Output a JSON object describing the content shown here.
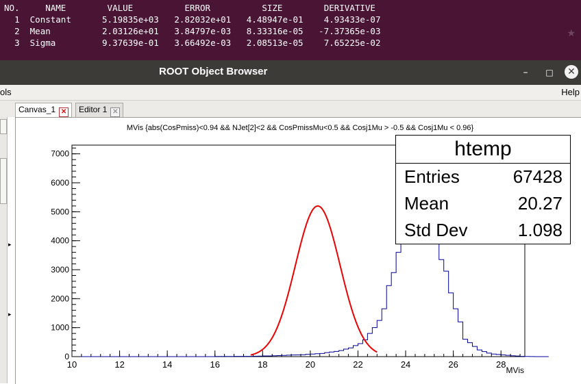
{
  "terminal": {
    "headers": [
      "NO.",
      "NAME",
      "VALUE",
      "ERROR",
      "SIZE",
      "DERIVATIVE"
    ],
    "rows": [
      [
        "1",
        "Constant",
        "5.19835e+03",
        "2.82032e+01",
        "4.48947e-01",
        "4.93433e-07"
      ],
      [
        "2",
        "Mean",
        "2.03126e+01",
        "3.84797e-03",
        "8.33316e-05",
        "-7.37365e-03"
      ],
      [
        "3",
        "Sigma",
        "9.37639e-01",
        "3.66492e-03",
        "2.08513e-05",
        "7.65225e-02"
      ]
    ]
  },
  "window": {
    "title": "ROOT Object Browser",
    "minimize": "–",
    "maximize": "□",
    "close": "✕"
  },
  "menubar": {
    "left": "ols",
    "right": "Help"
  },
  "tabs": [
    {
      "label": "Canvas_1",
      "close": "✕",
      "active": true
    },
    {
      "label": "Editor 1",
      "close": "✕",
      "active": false
    }
  ],
  "stats": {
    "title": "htemp",
    "rows": [
      {
        "key": "Entries",
        "value": "67428"
      },
      {
        "key": "Mean",
        "value": "20.27"
      },
      {
        "key": "Std Dev",
        "value": "1.098"
      }
    ]
  },
  "chart_data": {
    "type": "histogram",
    "title": "MVis {abs(CosPmiss)<0.94 && NJet[2]<2 && CosPmissMu<0.5 && Cosj1Mu > -0.5 && Cosj1Mu < 0.96}",
    "xlabel": "MVis",
    "ylabel": "",
    "xlim": [
      10,
      29
    ],
    "ylim": [
      0,
      7300
    ],
    "xticks": [
      10,
      12,
      14,
      16,
      18,
      20,
      22,
      24,
      26,
      28
    ],
    "yticks": [
      0,
      1000,
      2000,
      3000,
      4000,
      5000,
      6000,
      7000
    ],
    "bin_width": 0.2,
    "bins_start": 10,
    "values": [
      0,
      0,
      0,
      0,
      0,
      0,
      0,
      0,
      0,
      0,
      0,
      0,
      0,
      0,
      0,
      0,
      0,
      0,
      0,
      0,
      0,
      0,
      0,
      0,
      0,
      0,
      0,
      0,
      0,
      0,
      5,
      5,
      5,
      5,
      8,
      8,
      10,
      10,
      15,
      18,
      25,
      25,
      30,
      35,
      40,
      50,
      55,
      60,
      65,
      80,
      90,
      100,
      110,
      140,
      160,
      180,
      210,
      260,
      300,
      380,
      450,
      580,
      800,
      1000,
      1250,
      1650,
      2450,
      2900,
      3600,
      4200,
      5000,
      6200,
      6850,
      4550,
      5500,
      4900,
      4400,
      3350,
      2950,
      2200,
      1650,
      1200,
      600,
      480,
      350,
      230,
      175,
      120,
      90,
      75,
      60,
      45,
      30,
      20,
      10,
      5,
      3,
      0,
      0,
      0
    ],
    "fit": {
      "name": "gaus",
      "constant": 5198.35,
      "mean": 20.3126,
      "sigma": 0.937639,
      "range": [
        17.5,
        22.8
      ],
      "color": "#ee0000"
    },
    "histogram_color": "#000099"
  }
}
